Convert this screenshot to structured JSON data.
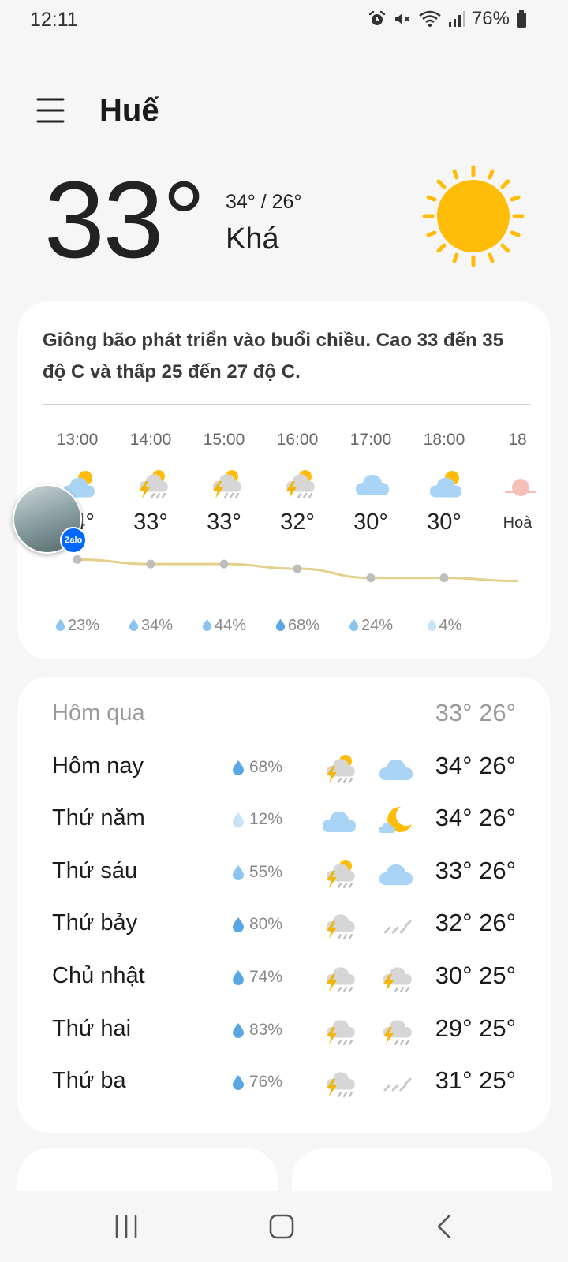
{
  "status": {
    "time": "12:11",
    "battery": "76%",
    "icons": [
      "alarm-icon",
      "mute-icon",
      "wifi-icon",
      "signal-icon",
      "battery-icon"
    ]
  },
  "header": {
    "city": "Huế",
    "menu_icon": "hamburger-menu-icon"
  },
  "current": {
    "temp": "33°",
    "hi_lo": "34° / 26°",
    "condition": "Khá",
    "icon": "sun-icon"
  },
  "summary": {
    "text": "Giông bão phát triển vào buổi chiều. Cao 33 đến 35 độ C và thấp 25 đến 27 độ C."
  },
  "hourly": [
    {
      "time": "13:00",
      "temp": "34°",
      "precip": "23%",
      "icon": "partly-cloudy-icon"
    },
    {
      "time": "14:00",
      "temp": "33°",
      "precip": "34%",
      "icon": "thunder-sun-icon"
    },
    {
      "time": "15:00",
      "temp": "33°",
      "precip": "44%",
      "icon": "thunder-sun-icon"
    },
    {
      "time": "16:00",
      "temp": "32°",
      "precip": "68%",
      "icon": "thunder-sun-icon"
    },
    {
      "time": "17:00",
      "temp": "30°",
      "precip": "24%",
      "icon": "cloud-icon"
    },
    {
      "time": "18:00",
      "temp": "30°",
      "precip": "4%",
      "icon": "partly-cloudy-icon"
    },
    {
      "time": "18",
      "label": "Hoà",
      "icon": "sunset-icon"
    }
  ],
  "daily": [
    {
      "day": "Hôm qua",
      "temps": "33° 26°"
    },
    {
      "day": "Hôm nay",
      "precip": "68%",
      "icon_day": "thunder-sun-icon",
      "icon_night": "cloud-icon",
      "temps": "34° 26°"
    },
    {
      "day": "Thứ năm",
      "precip": "12%",
      "icon_day": "cloud-icon",
      "icon_night": "moon-cloud-icon",
      "temps": "34° 26°"
    },
    {
      "day": "Thứ sáu",
      "precip": "55%",
      "icon_day": "thunder-sun-icon",
      "icon_night": "cloud-icon",
      "temps": "33° 26°"
    },
    {
      "day": "Thứ bảy",
      "precip": "80%",
      "icon_day": "thunder-icon",
      "icon_night": "rain-icon",
      "temps": "32° 26°"
    },
    {
      "day": "Chủ nhật",
      "precip": "74%",
      "icon_day": "thunder-icon",
      "icon_night": "thunder-icon",
      "temps": "30° 25°"
    },
    {
      "day": "Thứ hai",
      "precip": "83%",
      "icon_day": "thunder-icon",
      "icon_night": "thunder-icon",
      "temps": "29° 25°"
    },
    {
      "day": "Thứ ba",
      "precip": "76%",
      "icon_day": "thunder-icon",
      "icon_night": "rain-icon",
      "temps": "31° 25°"
    }
  ],
  "overlay": {
    "badge": "Zalo"
  },
  "colors": {
    "sun": "#FFBD0A",
    "cloud": "#A9D4F5",
    "drop": "#7DB9EC",
    "line": "#E4D08A"
  }
}
